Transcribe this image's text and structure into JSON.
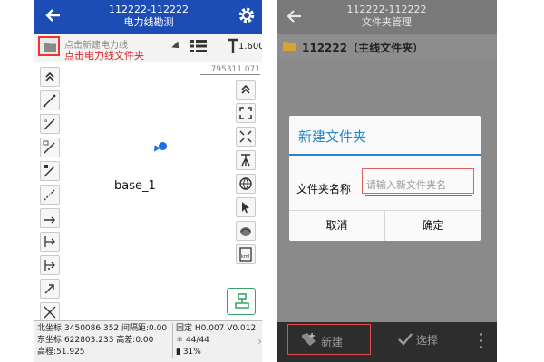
{
  "left": {
    "header": {
      "line1": "112222-112222",
      "line2": "电力线勘测"
    },
    "toolbar": {
      "folder_placeholder": "点击新建电力线",
      "annotation": "点击电力线文件夹",
      "pole_height": "1.600"
    },
    "coord_top": "795311.071",
    "map": {
      "point_label": "base_1"
    },
    "left_tools": [
      "chevrons-up-icon",
      "line-icon-1",
      "line-icon-2",
      "line-icon-3",
      "line-icon-4",
      "line-icon-5",
      "arrow-line-icon",
      "bracket-icon-1",
      "bracket-icon-2",
      "arrow-up-right-icon",
      "cross-icon"
    ],
    "right_tools": [
      "chevrons-up-icon",
      "fullscreen-icon",
      "shrink-icon",
      "survey-pole-icon",
      "globe-icon",
      "pointer-icon",
      "shell-icon",
      "kml-icon"
    ],
    "status": {
      "north": "北坐标:3450086.352 间隔距:0.00",
      "east": "东坐标:622803.233  高差:0.00",
      "elev": "高程:51.925",
      "fix": "固定 H0.007 V0.012",
      "sats": "44/44",
      "battery": "31%"
    },
    "colors": {
      "header": "#1c4db4",
      "annotation_red": "#e02020",
      "accent_blue": "#1a6ee8"
    }
  },
  "right": {
    "header": {
      "line1": "112222-112222",
      "line2": "文件夹管理"
    },
    "folder_item": "112222（主线文件夹）",
    "dialog": {
      "title": "新建文件夹",
      "label": "文件夹名称",
      "placeholder": "请输入新文件夹名",
      "cancel": "取消",
      "confirm": "确定"
    },
    "bottom": {
      "new": "新建",
      "select": "选择"
    },
    "colors": {
      "dialog_accent": "#2a86c8",
      "highlight_red": "#e34a4a",
      "bottom_bar": "#2d2d2d"
    }
  }
}
